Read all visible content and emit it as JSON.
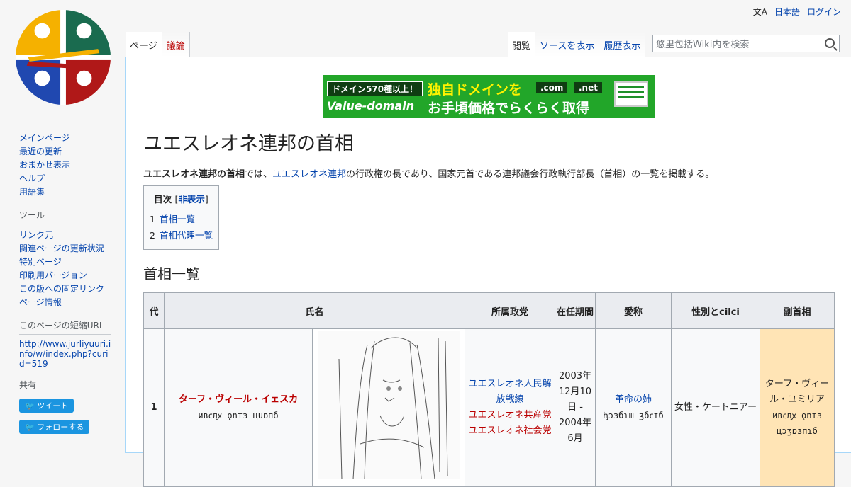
{
  "personal": {
    "lang_icon": "文A",
    "lang_link": "日本語",
    "login": "ログイン"
  },
  "tabs_left": [
    {
      "label": "ページ",
      "selected": true
    },
    {
      "label": "議論",
      "red": true
    }
  ],
  "tabs_right": [
    {
      "label": "閲覧",
      "selected": true
    },
    {
      "label": "ソースを表示"
    },
    {
      "label": "履歴表示"
    }
  ],
  "search": {
    "placeholder": "悠里包括Wiki内を検索"
  },
  "sidebar": {
    "nav": [
      "メインページ",
      "最近の更新",
      "おまかせ表示",
      "ヘルプ",
      "用語集"
    ],
    "tools_heading": "ツール",
    "tools": [
      "リンク元",
      "関連ページの更新状況",
      "特別ページ",
      "印刷用バージョン",
      "この版への固定リンク",
      "ページ情報"
    ],
    "shorturl_heading": "このページの短縮URL",
    "shorturl": "http://www.jurliyuuri.info/w/index.php?curid=519",
    "share_heading": "共有",
    "tweet": "ツイート",
    "follow": "フォローする"
  },
  "banner": {
    "badge": "ドメイン570種以上！",
    "brand": "Value-domain",
    "line1": "独自ドメインを",
    "line2": "お手頃価格でらくらく取得",
    "tld1": ".com",
    "tld2": ".net"
  },
  "page": {
    "title": "ユエスレオネ連邦の首相",
    "intro_bold": "ユエスレオネ連邦の首相",
    "intro_mid": "では、",
    "intro_link": "ユエスレオネ連邦",
    "intro_rest": "の行政権の長であり、国家元首である連邦議会行政執行部長（首相）の一覧を掲載する。"
  },
  "toc": {
    "heading": "目次",
    "toggle_open": "[",
    "toggle": "非表示",
    "toggle_close": "]",
    "items": [
      {
        "num": "1",
        "label": "首相一覧"
      },
      {
        "num": "2",
        "label": "首相代理一覧"
      }
    ]
  },
  "section": {
    "title": "首相一覧"
  },
  "table": {
    "headers": [
      "代",
      "氏名",
      "所属政党",
      "在任期間",
      "愛称",
      "性別とcilci",
      "副首相"
    ],
    "rows": [
      {
        "num": "1",
        "name": "ターフ・ヴィール・イェスカ",
        "name_script": "ивꞓлꭙ ǫnɪɜ цuɒпб",
        "parties": [
          "ユエスレオネ人民解放戦線",
          "ユエスレオネ共産党",
          "ユエスレオネ社会党"
        ],
        "term": "2003年12月10日 - 2004年6月",
        "nickname": "革命の姉",
        "nickname_script": "ꞕɔɜбɿш ʒбꞓтб",
        "gender": "女性・ケートニアー",
        "deputy": "ターフ・ヴィール・ユミリア",
        "deputy_script": "ивꞓлꭙ ǫnɪɜ цɔʒɒɜпɿб"
      }
    ]
  },
  "colors": {
    "link": "#0645ad",
    "redlink": "#ba0000",
    "deputy_bg": "#ffe4b5",
    "banner_green": "#22a629"
  }
}
